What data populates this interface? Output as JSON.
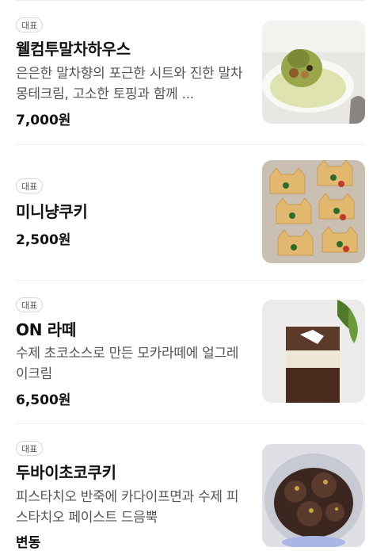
{
  "items": [
    {
      "badge": "대표",
      "name": "웰컴투말차하우스",
      "description": "은은한 말차향의 포근한 시트와 진한 말차몽테크림, 고소한 토핑과 함께 ...",
      "price": "7,000원",
      "image_icon": "matcha-cake-photo"
    },
    {
      "badge": "대표",
      "name": "미니냥쿠키",
      "description": "",
      "price": "2,500원",
      "image_icon": "cat-cookie-photo"
    },
    {
      "badge": "대표",
      "name": "ON 라떼",
      "description": "수제 초코소스로 만든 모카라떼에 얼그레이크림",
      "price": "6,500원",
      "image_icon": "latte-photo"
    },
    {
      "badge": "대표",
      "name": "두바이초코쿠키",
      "description": "피스타치오 반죽에 카다이프면과 수제 피스타치오 페이스트 드음뿍",
      "price": "변동",
      "image_icon": "dubai-cookie-photo"
    }
  ]
}
